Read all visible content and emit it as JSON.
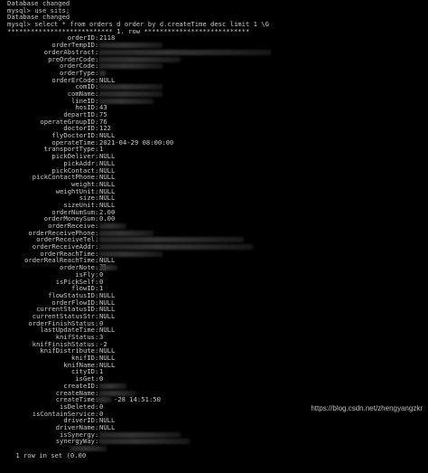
{
  "terminal": {
    "header_lines": [
      "Database changed",
      "mysql> use sits;",
      "Database changed",
      "mysql> select * from orders d order by d.createTime desc limit 1 \\G",
      "*************************** 1. row ***************************"
    ],
    "rows": [
      {
        "field": "orderID",
        "value": "2118"
      },
      {
        "field": "orderTempID",
        "value": ""
      },
      {
        "field": "orderAbstract",
        "value": ""
      },
      {
        "field": "preOrderCode",
        "value": ""
      },
      {
        "field": "orderCode",
        "value": ""
      },
      {
        "field": "orderType",
        "value": ""
      },
      {
        "field": "orderErCode",
        "value": "NULL"
      },
      {
        "field": "comID",
        "value": ""
      },
      {
        "field": "comName",
        "value": ""
      },
      {
        "field": "lineID",
        "value": ""
      },
      {
        "field": "hosID",
        "value": "43"
      },
      {
        "field": "departID",
        "value": "75"
      },
      {
        "field": "operateGroupID",
        "value": "76"
      },
      {
        "field": "doctorID",
        "value": "122"
      },
      {
        "field": "flyDoctorID",
        "value": "NULL"
      },
      {
        "field": "operateTime",
        "value": "2021-04-29 08:00:00"
      },
      {
        "field": "transportType",
        "value": "1"
      },
      {
        "field": "pickDeliver",
        "value": "NULL"
      },
      {
        "field": "pickAddr",
        "value": "NULL"
      },
      {
        "field": "pickContact",
        "value": "NULL"
      },
      {
        "field": "pickContactPhone",
        "value": "NULL"
      },
      {
        "field": "weight",
        "value": "NULL"
      },
      {
        "field": "weightUnit",
        "value": "NULL"
      },
      {
        "field": "size",
        "value": "NULL"
      },
      {
        "field": "sizeUnit",
        "value": "NULL"
      },
      {
        "field": "orderNumSum",
        "value": "2.00"
      },
      {
        "field": "orderMoneySum",
        "value": "0.00"
      },
      {
        "field": "orderReceive",
        "value": ""
      },
      {
        "field": "orderReceivePhone",
        "value": ""
      },
      {
        "field": "orderReceiveTel",
        "value": ""
      },
      {
        "field": "orderReceiveAddr",
        "value": ""
      },
      {
        "field": "orderReachTime",
        "value": ""
      },
      {
        "field": "orderRealReachTime",
        "value": "NULL"
      },
      {
        "field": "orderNote",
        "value": "测"
      },
      {
        "field": "isFly",
        "value": "0"
      },
      {
        "field": "isPickSelf",
        "value": "0"
      },
      {
        "field": "flowID",
        "value": "1"
      },
      {
        "field": "flowStatusID",
        "value": "NULL"
      },
      {
        "field": "orderFlowID",
        "value": "NULL"
      },
      {
        "field": "currentStatusID",
        "value": "NULL"
      },
      {
        "field": "currentStatusStr",
        "value": "NULL"
      },
      {
        "field": "orderFinishStatus",
        "value": "0"
      },
      {
        "field": "lastUpdateTime",
        "value": "NULL"
      },
      {
        "field": "knifStatus",
        "value": "3"
      },
      {
        "field": "knifFinishStatus",
        "value": "-2"
      },
      {
        "field": "knifDistribute",
        "value": "NULL"
      },
      {
        "field": "knifID",
        "value": "NULL"
      },
      {
        "field": "knifName",
        "value": "NULL"
      },
      {
        "field": "cityID",
        "value": "1"
      },
      {
        "field": "isGet",
        "value": "0"
      },
      {
        "field": "createID",
        "value": ""
      },
      {
        "field": "createName",
        "value": ""
      },
      {
        "field": "createTime",
        "value": "-28 14:51:50"
      },
      {
        "field": "isDeleted",
        "value": "0"
      },
      {
        "field": "isContainService",
        "value": "0"
      },
      {
        "field": "driverID",
        "value": "NULL"
      },
      {
        "field": "driverName",
        "value": "NULL"
      },
      {
        "field": "isSynergy",
        "value": ""
      },
      {
        "field": "synergyWay",
        "value": ""
      }
    ],
    "footer": "1 row in set (0.00",
    "watermark": "https://blog.csdn.net/zhengyangzkr"
  }
}
